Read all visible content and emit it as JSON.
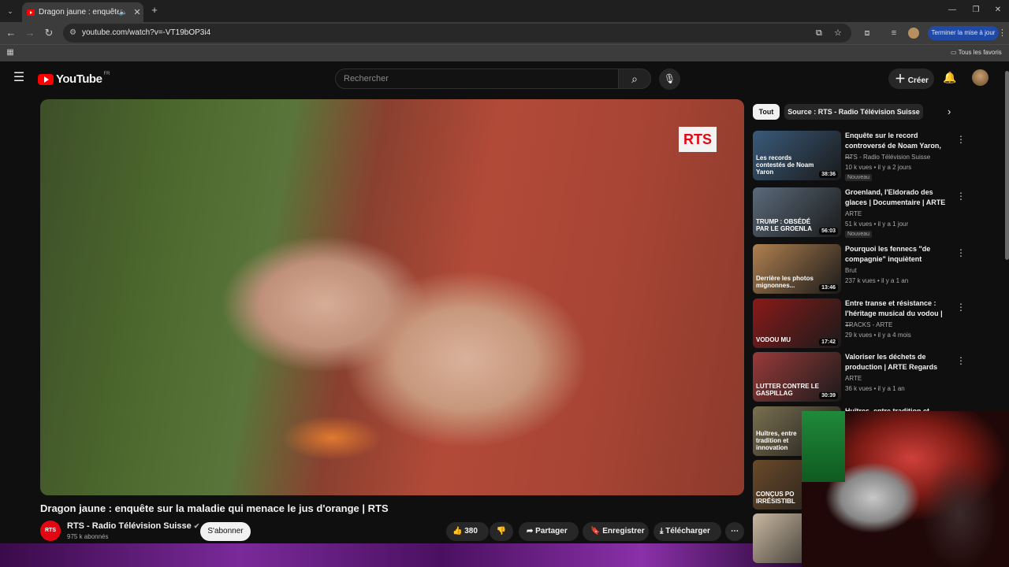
{
  "browser": {
    "tab_title": "Dragon jaune : enquête sur la maladie qui menace le jus d'orange | RTS",
    "url": "youtube.com/watch?v=-VT19bOP3i4",
    "update_button": "Terminer la mise à jour",
    "bookmarks_label": "Tous les favoris"
  },
  "header": {
    "logo_text": "YouTube",
    "country": "FR",
    "search_placeholder": "Rechercher",
    "create_label": "Créer"
  },
  "video": {
    "overlay_logo": "RTS",
    "title": "Dragon jaune : enquête sur la maladie qui menace le jus d'orange | RTS",
    "channel_avatar": "RTS",
    "channel_name": "RTS - Radio Télévision Suisse",
    "subscribers": "975 k abonnés",
    "subscribe_label": "S'abonner",
    "likes": "380",
    "share_label": "Partager",
    "save_label": "Enregistrer",
    "download_label": "Télécharger"
  },
  "chips": [
    "Tout",
    "Source : RTS - Radio Télévision Suisse"
  ],
  "recommendations": [
    {
      "title": "Enquête sur le record controversé de Noam Yaron, ...",
      "thumb_caption": "Les records contestés de Noam Yaron",
      "channel": "RTS - Radio Télévision Suisse",
      "meta": "10 k vues • il y a 2 jours",
      "duration": "38:36",
      "badge": "Nouveau",
      "color": "#3a5a7a"
    },
    {
      "title": "Groenland, l'Eldorado des glaces | Documentaire | ARTE",
      "thumb_caption": "TRUMP : OBSÉDÉ PAR LE GROENLA",
      "channel": "ARTE",
      "meta": "51 k vues • il y a 1 jour",
      "duration": "56:03",
      "badge": "Nouveau",
      "color": "#5a6a7a"
    },
    {
      "title": "Pourquoi les fennecs \"de compagnie\" inquiètent",
      "thumb_caption": "Derrière les photos mignonnes...",
      "channel": "Brut",
      "meta": "237 k vues • il y a 1 an",
      "duration": "13:46",
      "badge": "",
      "color": "#b08050"
    },
    {
      "title": "Entre transe et résistance : l'héritage musical du vodou | ...",
      "thumb_caption": "VODOU MU",
      "channel": "TRACKS - ARTE",
      "meta": "29 k vues • il y a 4 mois",
      "duration": "17:42",
      "badge": "",
      "color": "#8a1a1a"
    },
    {
      "title": "Valoriser les déchets de production | ARTE Regards",
      "thumb_caption": "LUTTER CONTRE LE GASPILLAG",
      "channel": "ARTE",
      "meta": "36 k vues • il y a 1 an",
      "duration": "30:39",
      "badge": "",
      "color": "#9a3a3a"
    },
    {
      "title": "Huîtres, entre tradition et ...",
      "thumb_caption": "Huîtres, entre tradition et innovation",
      "channel": "",
      "meta": "",
      "duration": "",
      "badge": "",
      "color": "#7a7050"
    },
    {
      "title": "",
      "thumb_caption": "CONÇUS PO IRRÉSISTIBL",
      "channel": "",
      "meta": "",
      "duration": "",
      "badge": "",
      "color": "#6a4a2a"
    },
    {
      "title": "",
      "thumb_caption": "",
      "channel": "",
      "meta": "",
      "duration": "",
      "badge": "",
      "color": "#c9b8a0"
    }
  ]
}
